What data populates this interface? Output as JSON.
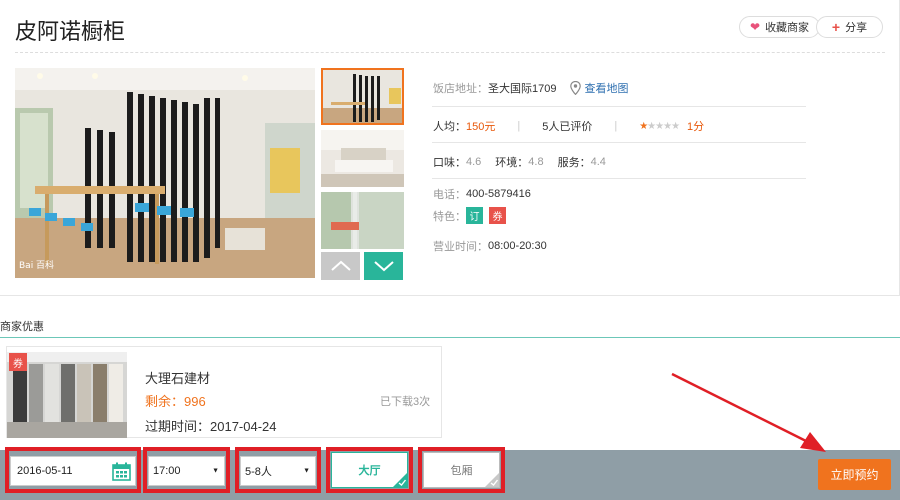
{
  "header": {
    "title": "皮阿诺橱柜",
    "favorite_label": "收藏商家",
    "share_label": "分享"
  },
  "gallery": {
    "up_icon": "chevron-up-icon",
    "down_icon": "chevron-down-icon"
  },
  "info": {
    "address_label": "饭店地址：",
    "address": "圣大国际1709",
    "map_link": "查看地图",
    "avg_label": "人均：",
    "avg_value": "150元",
    "reviews": "5人已评价",
    "rating": "1分",
    "rating_stars": 1,
    "taste_label": "口味：",
    "taste": "4.6",
    "env_label": "环境：",
    "env": "4.8",
    "service_label": "服务：",
    "service": "4.4",
    "phone_label": "电话：",
    "phone": "400-5879416",
    "feature_label": "特色：",
    "feature_tags": [
      "订",
      "券"
    ],
    "hours_label": "营业时间：",
    "hours": "08:00-20:30"
  },
  "promo": {
    "section_title": "商家优惠",
    "coupon": {
      "badge": "券",
      "name": "大理石建材",
      "remaining": "剩余：996",
      "downloaded": "已下载3次",
      "expiry": "过期时间：2017-04-24"
    }
  },
  "booking": {
    "date": "2016-05-11",
    "time": "17:00",
    "people": "5-8人",
    "hall": "大厅",
    "private_room": "包厢",
    "submit": "立即预约"
  },
  "colors": {
    "accent": "#f0731e",
    "green": "#29b59a",
    "highlight": "#e01f26",
    "bar": "#8f9ea6"
  }
}
